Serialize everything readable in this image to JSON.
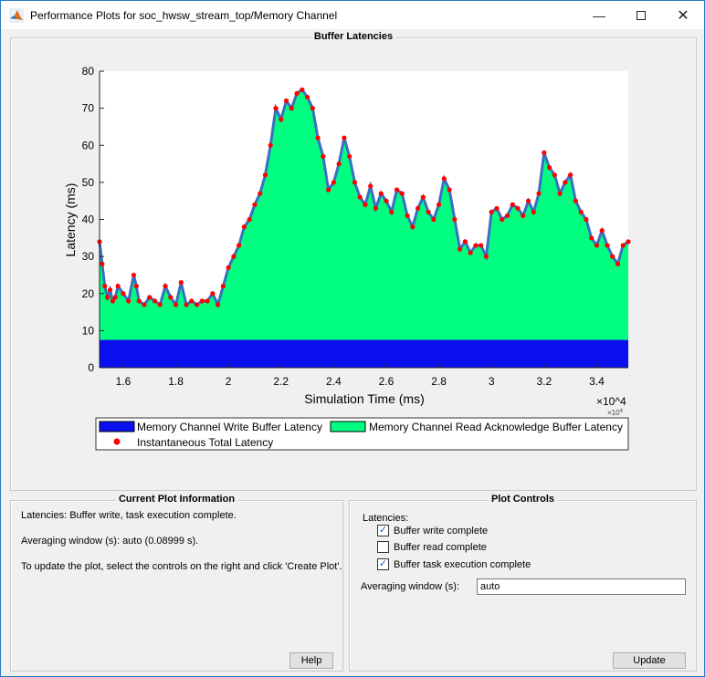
{
  "window": {
    "title": "Performance Plots for soc_hwsw_stream_top/Memory Channel"
  },
  "plot_panel": {
    "title": "Buffer Latencies"
  },
  "chart_data": {
    "type": "area",
    "xlabel": "Simulation Time (ms)",
    "ylabel": "Latency (ms)",
    "x_exponent_label": "×10^4",
    "x_exp_base": "×10",
    "x_exp_power": "4",
    "xlim": [
      1.51,
      3.52
    ],
    "ylim": [
      0,
      80
    ],
    "x_ticks": [
      1.6,
      1.8,
      2,
      2.2,
      2.4,
      2.6,
      2.8,
      3,
      3.2,
      3.4
    ],
    "x_tick_labels": [
      "1.6",
      "1.8",
      "2",
      "2.2",
      "2.4",
      "2.6",
      "2.8",
      "3",
      "3.2",
      "3.4"
    ],
    "y_ticks": [
      0,
      10,
      20,
      30,
      40,
      50,
      60,
      70,
      80
    ],
    "y_tick_labels": [
      "0",
      "10",
      "20",
      "30",
      "40",
      "50",
      "60",
      "70",
      "80"
    ],
    "write_latency": 7.5,
    "x": [
      1.51,
      1.52,
      1.53,
      1.54,
      1.55,
      1.56,
      1.57,
      1.58,
      1.6,
      1.62,
      1.64,
      1.65,
      1.66,
      1.68,
      1.7,
      1.72,
      1.74,
      1.76,
      1.78,
      1.8,
      1.82,
      1.84,
      1.86,
      1.88,
      1.9,
      1.92,
      1.94,
      1.96,
      1.98,
      2.0,
      2.02,
      2.04,
      2.06,
      2.08,
      2.1,
      2.12,
      2.14,
      2.16,
      2.18,
      2.2,
      2.22,
      2.24,
      2.26,
      2.28,
      2.3,
      2.32,
      2.34,
      2.36,
      2.38,
      2.4,
      2.42,
      2.44,
      2.46,
      2.48,
      2.5,
      2.52,
      2.54,
      2.56,
      2.58,
      2.6,
      2.62,
      2.64,
      2.66,
      2.68,
      2.7,
      2.72,
      2.74,
      2.76,
      2.78,
      2.8,
      2.82,
      2.84,
      2.86,
      2.88,
      2.9,
      2.92,
      2.94,
      2.96,
      2.98,
      3.0,
      3.02,
      3.04,
      3.06,
      3.08,
      3.1,
      3.12,
      3.14,
      3.16,
      3.18,
      3.2,
      3.22,
      3.24,
      3.26,
      3.28,
      3.3,
      3.32,
      3.34,
      3.36,
      3.38,
      3.4,
      3.42,
      3.44,
      3.46,
      3.48,
      3.5,
      3.52
    ],
    "total_latency": [
      34,
      28,
      22,
      19,
      21,
      18,
      19,
      22,
      20,
      18,
      25,
      22,
      18,
      17,
      19,
      18,
      17,
      22,
      19,
      17,
      23,
      17,
      18,
      17,
      18,
      18,
      20,
      17,
      22,
      27,
      30,
      33,
      38,
      40,
      44,
      47,
      52,
      60,
      70,
      67,
      72,
      70,
      74,
      75,
      73,
      70,
      62,
      57,
      48,
      50,
      55,
      62,
      57,
      50,
      46,
      44,
      49,
      43,
      47,
      45,
      42,
      48,
      47,
      41,
      38,
      43,
      46,
      42,
      40,
      44,
      51,
      48,
      40,
      32,
      34,
      31,
      33,
      33,
      30,
      42,
      43,
      40,
      41,
      44,
      43,
      41,
      45,
      42,
      47,
      58,
      54,
      52,
      47,
      50,
      52,
      45,
      42,
      40,
      35,
      33,
      37,
      33,
      30,
      28,
      33,
      34
    ],
    "legend": [
      "Memory Channel Write Buffer Latency",
      "Memory Channel Read Acknowledge Buffer Latency",
      "Instantaneous Total Latency"
    ],
    "legend_placement": "bottom",
    "colors": {
      "write": "#0a10f0",
      "read": "#00ff80",
      "total": "#ff0000",
      "line": "#3a6fc0"
    }
  },
  "info_panel": {
    "title": "Current Plot Information",
    "line1": "Latencies: Buffer write, task execution complete.",
    "line2": "Averaging window (s): auto (0.08999 s).",
    "line3": "To update the plot, select the controls on the right and click 'Create Plot'.",
    "help_label": "Help"
  },
  "controls_panel": {
    "title": "Plot Controls",
    "latencies_label": "Latencies:",
    "checkboxes": [
      {
        "label": "Buffer write complete",
        "checked": true
      },
      {
        "label": "Buffer read complete",
        "checked": false
      },
      {
        "label": "Buffer task execution complete",
        "checked": true
      }
    ],
    "check_mark": "✓",
    "avg_label": "Averaging window (s):",
    "avg_value": "auto",
    "update_label": "Update"
  }
}
